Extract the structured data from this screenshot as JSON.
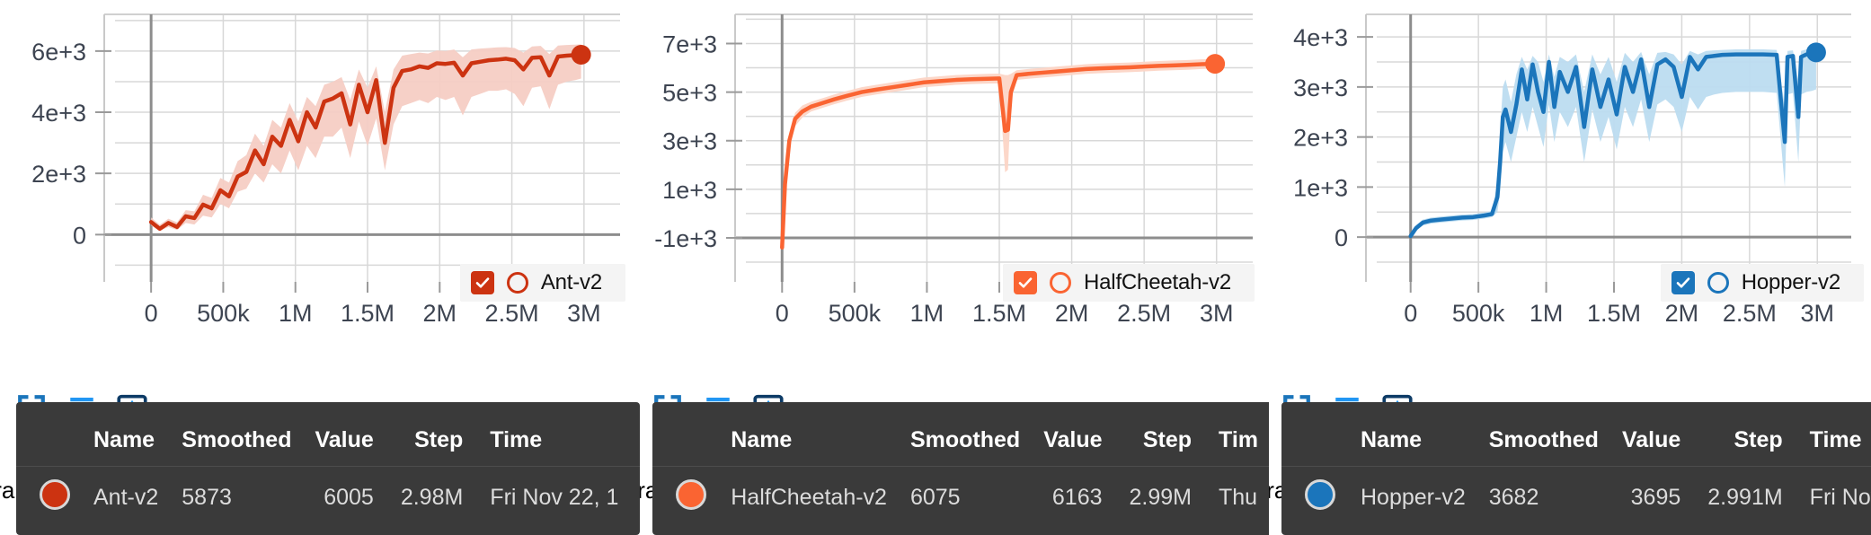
{
  "panels": [
    {
      "id": "ant",
      "run_label": "train",
      "accent": "#cc3311",
      "band": "#f5cdc4",
      "legend": {
        "label": "Ant-v2",
        "checked": true,
        "checkbox_color": "#cc3311",
        "ring_color": "#cc3311"
      },
      "toolbar": [
        {
          "name": "fit-domain-icon",
          "title": "Fit domain to data"
        },
        {
          "name": "data-table-icon",
          "title": "Toggle data table"
        },
        {
          "name": "pan-icon",
          "title": "Pan / drag"
        }
      ],
      "tooltip": {
        "columns": [
          "Name",
          "Smoothed",
          "Value",
          "Step",
          "Time"
        ],
        "rows": [
          {
            "name": "Ant-v2",
            "smoothed": "5873",
            "value": "6005",
            "step": "2.98M",
            "time": "Fri Nov 22, 1"
          }
        ]
      },
      "chart_data": {
        "type": "line",
        "title": "Ant-v2",
        "xlabel": "",
        "ylabel": "",
        "xlim": [
          -250000,
          3250000
        ],
        "ylim": [
          -900,
          7200
        ],
        "xticks": [
          0,
          500000,
          1000000,
          1500000,
          2000000,
          2500000,
          3000000
        ],
        "xticklabels": [
          "0",
          "500k",
          "1M",
          "1.5M",
          "2M",
          "2.5M",
          "3M"
        ],
        "yticks": [
          0,
          2000,
          4000,
          6000
        ],
        "yticklabels": [
          "0",
          "2e+3",
          "4e+3",
          "6e+3"
        ],
        "grid": true,
        "legend_position": "bottom-right",
        "series": [
          {
            "name": "Ant-v2",
            "color": "#cc3311",
            "band_color": "#f5cdc4",
            "final_marker": true,
            "x": [
              0,
              60000,
              120000,
              180000,
              240000,
              300000,
              360000,
              420000,
              480000,
              540000,
              600000,
              660000,
              720000,
              780000,
              840000,
              900000,
              960000,
              1020000,
              1080000,
              1140000,
              1200000,
              1260000,
              1320000,
              1380000,
              1440000,
              1500000,
              1560000,
              1620000,
              1680000,
              1740000,
              1800000,
              1860000,
              1920000,
              1980000,
              2040000,
              2100000,
              2160000,
              2220000,
              2280000,
              2340000,
              2400000,
              2460000,
              2520000,
              2580000,
              2640000,
              2700000,
              2760000,
              2820000,
              2880000,
              2940000,
              2980000
            ],
            "y": [
              410,
              190,
              380,
              250,
              600,
              540,
              980,
              860,
              1450,
              1250,
              1900,
              2050,
              2750,
              2300,
              3200,
              2900,
              3750,
              3050,
              4000,
              3500,
              4350,
              4450,
              4620,
              3600,
              4900,
              4000,
              5050,
              3000,
              4800,
              5350,
              5400,
              5500,
              5450,
              5600,
              5580,
              5620,
              5200,
              5600,
              5650,
              5700,
              5720,
              5750,
              5700,
              5400,
              5780,
              5800,
              5200,
              5820,
              5850,
              5870,
              5880
            ],
            "band_low": [
              300,
              120,
              250,
              150,
              380,
              330,
              620,
              560,
              1000,
              860,
              1400,
              1500,
              2000,
              1700,
              2300,
              2000,
              2750,
              2100,
              2900,
              2500,
              3200,
              3200,
              3500,
              2500,
              3700,
              2900,
              3800,
              2100,
              3600,
              4200,
              4300,
              4400,
              4300,
              4500,
              4400,
              4500,
              3900,
              4500,
              4600,
              4700,
              4700,
              4750,
              4600,
              4200,
              4800,
              4850,
              4100,
              4900,
              5000,
              5050,
              5100
            ],
            "band_high": [
              560,
              320,
              520,
              400,
              800,
              760,
              1300,
              1200,
              1850,
              1700,
              2400,
              2600,
              3300,
              2900,
              3750,
              3500,
              4300,
              3700,
              4500,
              4200,
              4900,
              5000,
              5150,
              4400,
              5400,
              4800,
              5500,
              4000,
              5400,
              5850,
              5900,
              5950,
              5920,
              6020,
              6000,
              6050,
              5800,
              6050,
              6080,
              6100,
              6120,
              6130,
              6100,
              5950,
              6150,
              6170,
              5900,
              6180,
              6200,
              6210,
              6220
            ]
          }
        ]
      }
    },
    {
      "id": "halfcheetah",
      "run_label": "train",
      "accent": "#fa6432",
      "band": "#fcd5c6",
      "legend": {
        "label": "HalfCheetah-v2",
        "checked": true,
        "checkbox_color": "#fa6432",
        "ring_color": "#fa6432"
      },
      "toolbar": [
        {
          "name": "fit-domain-icon",
          "title": "Fit domain to data"
        },
        {
          "name": "data-table-icon",
          "title": "Toggle data table"
        },
        {
          "name": "pan-icon",
          "title": "Pan / drag"
        }
      ],
      "tooltip": {
        "columns": [
          "Name",
          "Smoothed",
          "Value",
          "Step",
          "Tim"
        ],
        "rows": [
          {
            "name": "HalfCheetah-v2",
            "smoothed": "6075",
            "value": "6163",
            "step": "2.99M",
            "time": "Thu"
          }
        ]
      },
      "chart_data": {
        "type": "line",
        "title": "HalfCheetah-v2",
        "xlabel": "",
        "ylabel": "",
        "xlim": [
          -250000,
          3250000
        ],
        "ylim": [
          -2000,
          8200
        ],
        "xticks": [
          0,
          500000,
          1000000,
          1500000,
          2000000,
          2500000,
          3000000
        ],
        "xticklabels": [
          "0",
          "500k",
          "1M",
          "1.5M",
          "2M",
          "2.5M",
          "3M"
        ],
        "yticks": [
          -1000,
          1000,
          3000,
          5000,
          7000
        ],
        "yticklabels": [
          "-1e+3",
          "1e+3",
          "3e+3",
          "5e+3",
          "7e+3"
        ],
        "grid": true,
        "legend_position": "bottom-right",
        "series": [
          {
            "name": "HalfCheetah-v2",
            "color": "#fa6432",
            "band_color": "#fcd5c6",
            "final_marker": true,
            "x": [
              0,
              20000,
              50000,
              90000,
              140000,
              200000,
              280000,
              360000,
              450000,
              550000,
              650000,
              760000,
              870000,
              980000,
              1090000,
              1200000,
              1310000,
              1420000,
              1500000,
              1540000,
              1560000,
              1580000,
              1620000,
              1700000,
              1800000,
              1900000,
              2000000,
              2100000,
              2200000,
              2300000,
              2400000,
              2500000,
              2600000,
              2700000,
              2800000,
              2900000,
              2990000
            ],
            "y": [
              -1400,
              1200,
              3000,
              3900,
              4200,
              4400,
              4550,
              4700,
              4850,
              5000,
              5100,
              5200,
              5300,
              5400,
              5450,
              5500,
              5530,
              5550,
              5560,
              3400,
              3450,
              5000,
              5700,
              5750,
              5800,
              5850,
              5900,
              5950,
              5980,
              6000,
              6020,
              6050,
              6080,
              6100,
              6120,
              6150,
              6163
            ],
            "band_low": [
              -1500,
              900,
              2700,
              3600,
              3950,
              4200,
              4350,
              4500,
              4650,
              4800,
              4900,
              5000,
              5100,
              5200,
              5250,
              5300,
              5330,
              5350,
              5360,
              1700,
              1800,
              4600,
              5500,
              5550,
              5600,
              5650,
              5700,
              5750,
              5780,
              5800,
              5820,
              5850,
              5880,
              5900,
              5920,
              5950,
              5970
            ],
            "band_high": [
              -1300,
              1500,
              3300,
              4150,
              4450,
              4600,
              4750,
              4900,
              5050,
              5200,
              5300,
              5400,
              5500,
              5600,
              5650,
              5700,
              5730,
              5750,
              5760,
              5700,
              5700,
              5750,
              5900,
              5950,
              6000,
              6050,
              6100,
              6150,
              6180,
              6200,
              6220,
              6250,
              6280,
              6300,
              6320,
              6350,
              6360
            ]
          }
        ]
      }
    },
    {
      "id": "hopper",
      "run_label": "train",
      "accent": "#1b75bb",
      "band": "#bcdcf0",
      "legend": {
        "label": "Hopper-v2",
        "checked": true,
        "checkbox_color": "#1b75bb",
        "ring_color": "#1b75bb"
      },
      "toolbar": [
        {
          "name": "fit-domain-icon",
          "title": "Fit domain to data"
        },
        {
          "name": "data-table-icon",
          "title": "Toggle data table"
        },
        {
          "name": "pan-icon",
          "title": "Pan / drag"
        }
      ],
      "tooltip": {
        "columns": [
          "Name",
          "Smoothed",
          "Value",
          "Step",
          "Time"
        ],
        "rows": [
          {
            "name": "Hopper-v2",
            "smoothed": "3682",
            "value": "3695",
            "step": "2.991M",
            "time": "Fri Nov"
          }
        ]
      },
      "chart_data": {
        "type": "line",
        "title": "Hopper-v2",
        "xlabel": "",
        "ylabel": "",
        "xlim": [
          -250000,
          3250000
        ],
        "ylim": [
          -500,
          4450
        ],
        "xticks": [
          0,
          500000,
          1000000,
          1500000,
          2000000,
          2500000,
          3000000
        ],
        "xticklabels": [
          "0",
          "500k",
          "1M",
          "1.5M",
          "2M",
          "2.5M",
          "3M"
        ],
        "yticks": [
          0,
          1000,
          2000,
          3000,
          4000
        ],
        "yticklabels": [
          "0",
          "1e+3",
          "2e+3",
          "3e+3",
          "4e+3"
        ],
        "grid": true,
        "legend_position": "bottom-right",
        "series": [
          {
            "name": "Hopper-v2",
            "color": "#1b75bb",
            "band_color": "#bcdcf0",
            "final_marker": true,
            "x": [
              0,
              40000,
              90000,
              150000,
              220000,
              300000,
              380000,
              460000,
              540000,
              600000,
              640000,
              660000,
              680000,
              700000,
              740000,
              780000,
              820000,
              860000,
              900000,
              940000,
              980000,
              1020000,
              1060000,
              1100000,
              1160000,
              1220000,
              1280000,
              1340000,
              1400000,
              1460000,
              1520000,
              1580000,
              1640000,
              1700000,
              1760000,
              1820000,
              1880000,
              1940000,
              2000000,
              2060000,
              2120000,
              2180000,
              2240000,
              2300000,
              2400000,
              2500000,
              2600000,
              2700000,
              2760000,
              2780000,
              2820000,
              2860000,
              2880000,
              2920000,
              2960000,
              2991000
            ],
            "y": [
              20,
              180,
              290,
              330,
              350,
              370,
              390,
              400,
              430,
              460,
              800,
              1500,
              2400,
              2550,
              2100,
              2650,
              3350,
              2750,
              3450,
              2900,
              2500,
              3500,
              2600,
              3300,
              2900,
              3400,
              2200,
              3350,
              2600,
              3150,
              2450,
              3400,
              2900,
              3550,
              2600,
              3450,
              3550,
              3400,
              2800,
              3600,
              3350,
              3600,
              3620,
              3640,
              3650,
              3650,
              3650,
              3640,
              1900,
              3600,
              3620,
              2400,
              3600,
              3650,
              3660,
              3690
            ],
            "band_low": [
              0,
              120,
              230,
              270,
              290,
              310,
              330,
              340,
              370,
              400,
              500,
              900,
              1700,
              1900,
              1500,
              2000,
              2500,
              2100,
              2600,
              2200,
              1800,
              2650,
              1900,
              2500,
              2200,
              2600,
              1500,
              2550,
              1900,
              2400,
              1750,
              2600,
              2200,
              2750,
              1900,
              2650,
              2750,
              2600,
              2100,
              2800,
              2550,
              2800,
              2850,
              2880,
              2900,
              2900,
              2900,
              2880,
              1000,
              2850,
              2880,
              1500,
              2850,
              2900,
              2920,
              2950
            ],
            "band_high": [
              60,
              240,
              350,
              390,
              410,
              430,
              450,
              460,
              490,
              520,
              1100,
              2100,
              3000,
              3150,
              2700,
              3250,
              3600,
              3350,
              3620,
              3500,
              3100,
              3650,
              3200,
              3600,
              3500,
              3650,
              2900,
              3650,
              3250,
              3600,
              3100,
              3680,
              3500,
              3700,
              3250,
              3680,
              3700,
              3650,
              3450,
              3720,
              3650,
              3720,
              3730,
              3740,
              3750,
              3750,
              3750,
              3740,
              2600,
              3720,
              3730,
              3100,
              3720,
              3750,
              3760,
              3780
            ]
          }
        ]
      }
    }
  ]
}
